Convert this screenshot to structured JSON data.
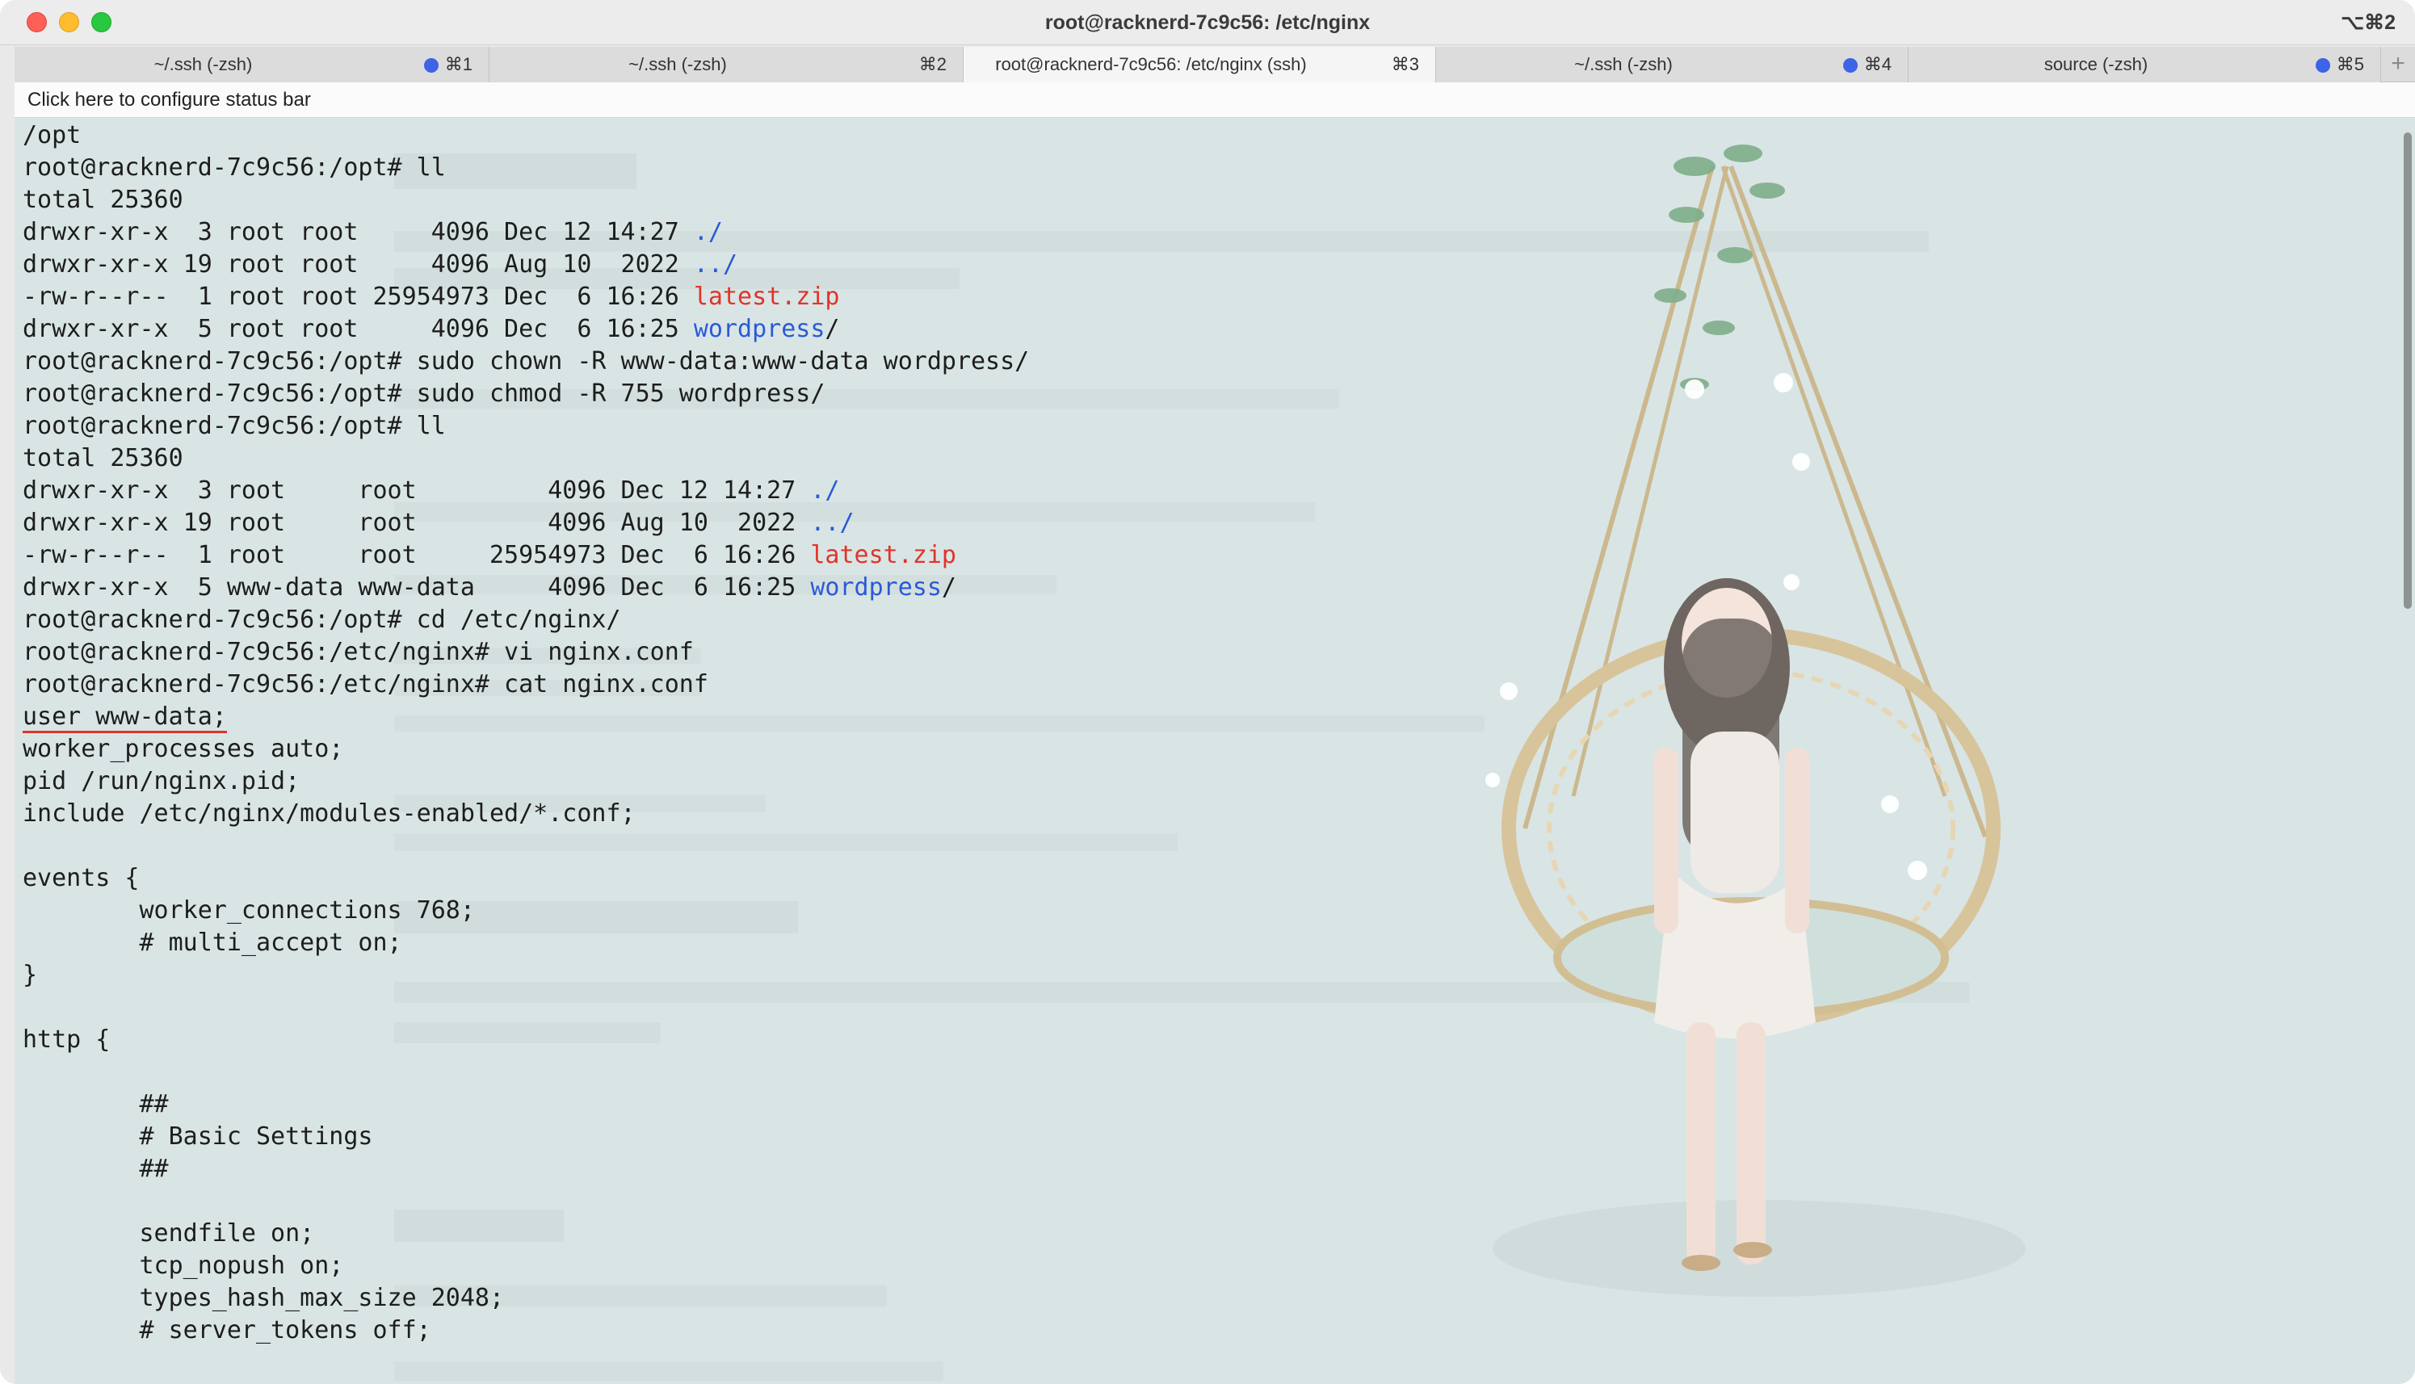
{
  "window": {
    "title": "root@racknerd-7c9c56: /etc/nginx",
    "shortcut": "⌥⌘2"
  },
  "tabs": [
    {
      "label": "~/.ssh (-zsh)",
      "key": "⌘1",
      "dot": true,
      "active": false
    },
    {
      "label": "~/.ssh (-zsh)",
      "key": "⌘2",
      "dot": false,
      "active": false
    },
    {
      "label": "root@racknerd-7c9c56: /etc/nginx (ssh)",
      "key": "⌘3",
      "dot": false,
      "active": true
    },
    {
      "label": "~/.ssh (-zsh)",
      "key": "⌘4",
      "dot": true,
      "active": false
    },
    {
      "label": "source (-zsh)",
      "key": "⌘5",
      "dot": true,
      "active": false
    }
  ],
  "tab_add": "+",
  "status_bar": {
    "text": "Click here to configure status bar"
  },
  "terminal": {
    "lines": [
      {
        "segments": [
          {
            "text": "/opt"
          }
        ]
      },
      {
        "segments": [
          {
            "text": "root@racknerd-7c9c56:/opt# ll"
          }
        ]
      },
      {
        "segments": [
          {
            "text": "total 25360"
          }
        ]
      },
      {
        "segments": [
          {
            "text": "drwxr-xr-x  3 root root     4096 Dec 12 14:27 "
          },
          {
            "text": "./",
            "color": "blue"
          }
        ]
      },
      {
        "segments": [
          {
            "text": "drwxr-xr-x 19 root root     4096 Aug 10  2022 "
          },
          {
            "text": "../",
            "color": "blue"
          }
        ]
      },
      {
        "segments": [
          {
            "text": "-rw-r--r--  1 root root 25954973 Dec  6 16:26 "
          },
          {
            "text": "latest.zip",
            "color": "red"
          }
        ]
      },
      {
        "segments": [
          {
            "text": "drwxr-xr-x  5 root root     4096 Dec  6 16:25 "
          },
          {
            "text": "wordpress",
            "color": "blue"
          },
          {
            "text": "/"
          }
        ]
      },
      {
        "segments": [
          {
            "text": "root@racknerd-7c9c56:/opt# sudo chown -R www-data:www-data wordpress/"
          }
        ]
      },
      {
        "segments": [
          {
            "text": "root@racknerd-7c9c56:/opt# sudo chmod -R 755 wordpress/"
          }
        ]
      },
      {
        "segments": [
          {
            "text": "root@racknerd-7c9c56:/opt# ll"
          }
        ]
      },
      {
        "segments": [
          {
            "text": "total 25360"
          }
        ]
      },
      {
        "segments": [
          {
            "text": "drwxr-xr-x  3 root     root         4096 Dec 12 14:27 "
          },
          {
            "text": "./",
            "color": "blue"
          }
        ]
      },
      {
        "segments": [
          {
            "text": "drwxr-xr-x 19 root     root         4096 Aug 10  2022 "
          },
          {
            "text": "../",
            "color": "blue"
          }
        ]
      },
      {
        "segments": [
          {
            "text": "-rw-r--r--  1 root     root     25954973 Dec  6 16:26 "
          },
          {
            "text": "latest.zip",
            "color": "red"
          }
        ]
      },
      {
        "segments": [
          {
            "text": "drwxr-xr-x  5 www-data www-data     4096 Dec  6 16:25 "
          },
          {
            "text": "wordpress",
            "color": "blue"
          },
          {
            "text": "/"
          }
        ]
      },
      {
        "segments": [
          {
            "text": "root@racknerd-7c9c56:/opt# cd /etc/nginx/"
          }
        ]
      },
      {
        "segments": [
          {
            "text": "root@racknerd-7c9c56:/etc/nginx# vi nginx.conf"
          }
        ]
      },
      {
        "segments": [
          {
            "text": "root@racknerd-7c9c56:/etc/nginx# cat nginx.conf"
          }
        ]
      },
      {
        "segments": [
          {
            "text": "user www-data;",
            "underline": true
          }
        ]
      },
      {
        "segments": [
          {
            "text": "worker_processes auto;"
          }
        ]
      },
      {
        "segments": [
          {
            "text": "pid /run/nginx.pid;"
          }
        ]
      },
      {
        "segments": [
          {
            "text": "include /etc/nginx/modules-enabled/*.conf;"
          }
        ]
      },
      {
        "segments": [
          {
            "text": ""
          }
        ]
      },
      {
        "segments": [
          {
            "text": "events {"
          }
        ]
      },
      {
        "segments": [
          {
            "text": "        worker_connections 768;"
          }
        ]
      },
      {
        "segments": [
          {
            "text": "        # multi_accept on;"
          }
        ]
      },
      {
        "segments": [
          {
            "text": "}"
          }
        ]
      },
      {
        "segments": [
          {
            "text": ""
          }
        ]
      },
      {
        "segments": [
          {
            "text": "http {"
          }
        ]
      },
      {
        "segments": [
          {
            "text": ""
          }
        ]
      },
      {
        "segments": [
          {
            "text": "        ##"
          }
        ]
      },
      {
        "segments": [
          {
            "text": "        # Basic Settings"
          }
        ]
      },
      {
        "segments": [
          {
            "text": "        ##"
          }
        ]
      },
      {
        "segments": [
          {
            "text": ""
          }
        ]
      },
      {
        "segments": [
          {
            "text": "        sendfile on;"
          }
        ]
      },
      {
        "segments": [
          {
            "text": "        tcp_nopush on;"
          }
        ]
      },
      {
        "segments": [
          {
            "text": "        types_hash_max_size 2048;"
          }
        ]
      },
      {
        "segments": [
          {
            "text": "        # server_tokens off;"
          }
        ]
      }
    ]
  },
  "colors": {
    "red": "#e0342b",
    "blue": "#2a5ad8",
    "terminal_bg": "#d9e5e4",
    "tab_dot": "#3d63e6"
  },
  "icons": {
    "close": "close-window-icon",
    "minimize": "minimize-window-icon",
    "maximize": "maximize-window-icon",
    "new_tab": "plus-icon"
  }
}
